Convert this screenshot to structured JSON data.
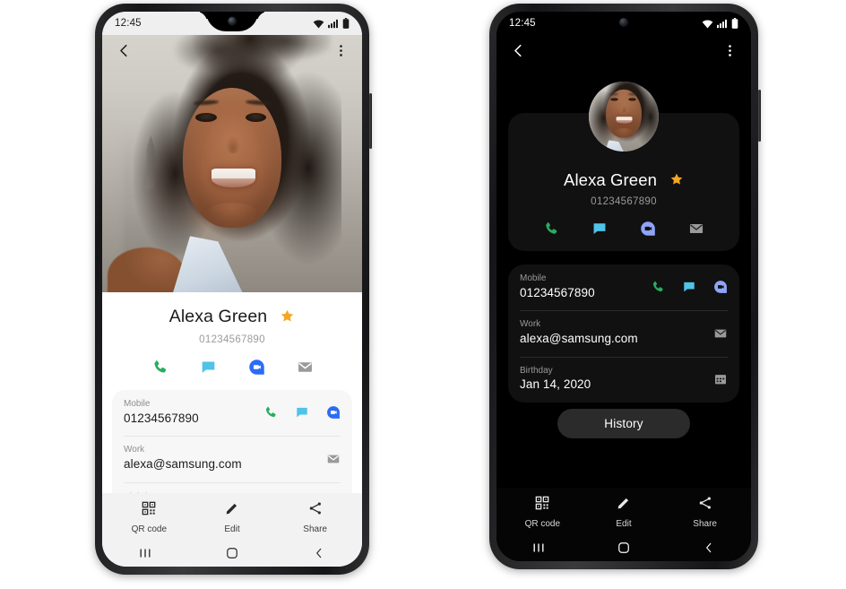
{
  "screenshot": {
    "description": "Two Samsung phones side by side showing a contact detail screen in light mode (left) and dark mode (right)",
    "background_color": "#ffffff"
  },
  "colors": {
    "accent_star": "#f5a623",
    "call_green": "#27ae60",
    "message_cyan": "#4fc3e8",
    "duo_blue": "#2b6cf5",
    "duo_blue_dark": "#8ea4f7",
    "mail_gray": "#9a9a9a",
    "light_card_bg": "#f7f7f7",
    "dark_card_bg": "#111111",
    "history_btn_bg": "#2b2b2b"
  },
  "phones": [
    {
      "id": "phone-left",
      "theme": "light",
      "status_bar": {
        "clock": "12:45",
        "icons": [
          "wifi-icon",
          "signal-icon",
          "battery-icon"
        ]
      },
      "app_bar": {
        "back": "back-arrow-icon",
        "more": "more-options-icon"
      },
      "header": {
        "type": "full-photo",
        "alt": "Smiling woman with long curly dark hair outdoors"
      },
      "contact": {
        "name": "Alexa Green",
        "favorite": true,
        "favorite_icon": "star-icon",
        "number": "01234567890"
      },
      "quick_actions": [
        {
          "name": "call",
          "icon": "phone-icon",
          "color": "#27ae60"
        },
        {
          "name": "message",
          "icon": "message-icon",
          "color": "#4fc3e8"
        },
        {
          "name": "video-call",
          "icon": "duo-video-icon",
          "color": "#2b6cf5"
        },
        {
          "name": "email",
          "icon": "mail-icon",
          "color": "#9a9a9a"
        }
      ],
      "details": [
        {
          "label": "Mobile",
          "value": "01234567890",
          "icons": [
            "phone-icon",
            "message-icon",
            "duo-video-icon"
          ]
        },
        {
          "label": "Work",
          "value": "alexa@samsung.com",
          "icons": [
            "mail-icon"
          ]
        },
        {
          "label": "Birthday",
          "value": "",
          "icons": [
            "calendar-icon"
          ]
        }
      ],
      "bottom_tools": [
        {
          "label": "QR code",
          "icon": "qr-code-icon"
        },
        {
          "label": "Edit",
          "icon": "pencil-icon"
        },
        {
          "label": "Share",
          "icon": "share-icon"
        }
      ],
      "nav_bar": [
        "recents-icon",
        "home-icon",
        "back-icon"
      ]
    },
    {
      "id": "phone-right",
      "theme": "dark",
      "status_bar": {
        "clock": "12:45",
        "icons": [
          "wifi-icon",
          "signal-icon",
          "battery-icon"
        ]
      },
      "app_bar": {
        "back": "back-arrow-icon",
        "more": "more-options-icon"
      },
      "header": {
        "type": "circle-avatar",
        "alt": "Smiling woman with long curly dark hair outdoors"
      },
      "contact": {
        "name": "Alexa Green",
        "favorite": true,
        "favorite_icon": "star-icon",
        "number": "01234567890"
      },
      "quick_actions": [
        {
          "name": "call",
          "icon": "phone-icon",
          "color": "#27ae60"
        },
        {
          "name": "message",
          "icon": "message-icon",
          "color": "#4fc3e8"
        },
        {
          "name": "video-call",
          "icon": "duo-video-icon",
          "color": "#8ea4f7"
        },
        {
          "name": "email",
          "icon": "mail-icon",
          "color": "#9a9a9a"
        }
      ],
      "details": [
        {
          "label": "Mobile",
          "value": "01234567890",
          "icons": [
            "phone-icon",
            "message-icon",
            "duo-video-icon"
          ]
        },
        {
          "label": "Work",
          "value": "alexa@samsung.com",
          "icons": [
            "mail-icon"
          ]
        },
        {
          "label": "Birthday",
          "value": "Jan 14, 2020",
          "icons": [
            "calendar-icon"
          ]
        }
      ],
      "history_button": "History",
      "bottom_tools": [
        {
          "label": "QR code",
          "icon": "qr-code-icon"
        },
        {
          "label": "Edit",
          "icon": "pencil-icon"
        },
        {
          "label": "Share",
          "icon": "share-icon"
        }
      ],
      "nav_bar": [
        "recents-icon",
        "home-icon",
        "back-icon"
      ]
    }
  ]
}
